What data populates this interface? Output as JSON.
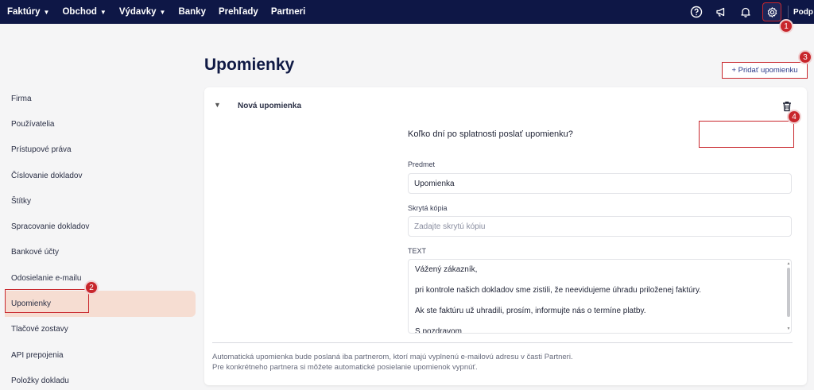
{
  "nav": {
    "items": [
      {
        "label": "Faktúry",
        "dropdown": true
      },
      {
        "label": "Obchod",
        "dropdown": true
      },
      {
        "label": "Výdavky",
        "dropdown": true
      },
      {
        "label": "Banky",
        "dropdown": false
      },
      {
        "label": "Prehľady",
        "dropdown": false
      },
      {
        "label": "Partneri",
        "dropdown": false
      }
    ],
    "icons": [
      "help-icon",
      "megaphone-icon",
      "bell-icon",
      "gear-icon"
    ],
    "user_label": "Podp"
  },
  "callouts": [
    "1",
    "2",
    "3",
    "4"
  ],
  "sidebar": {
    "items": [
      {
        "label": "Firma"
      },
      {
        "label": "Používatelia"
      },
      {
        "label": "Prístupové práva"
      },
      {
        "label": "Číslovanie dokladov"
      },
      {
        "label": "Štítky"
      },
      {
        "label": "Spracovanie dokladov"
      },
      {
        "label": "Bankové účty"
      },
      {
        "label": "Odosielanie e-mailu"
      },
      {
        "label": "Upomienky",
        "active": true
      },
      {
        "label": "Tlačové zostavy"
      },
      {
        "label": "API prepojenia"
      },
      {
        "label": "Položky dokladu"
      }
    ]
  },
  "main": {
    "title": "Upomienky",
    "add_button": "+ Pridať upomienku",
    "card": {
      "title": "Nová upomienka",
      "days_question": "Koľko dní po splatnosti poslať upomienku?",
      "days_value": "",
      "subject_label": "Predmet",
      "subject_value": "Upomienka",
      "bcc_label": "Skrytá kópia",
      "bcc_placeholder": "Zadajte skrytú kópiu",
      "text_label": "TEXT",
      "text_lines": [
        "Vážený zákazník,",
        "pri kontrole našich dokladov sme zistili, že neevidujeme úhradu priloženej faktúry.",
        "Ak ste faktúru už uhradili, prosím, informujte nás o termíne platby.",
        "S pozdravom"
      ],
      "note_lines": [
        "Automatická upomienka bude poslaná iba partnerom, ktorí majú vyplnenú e-mailovú adresu v časti Partneri.",
        "Pre konkrétneho partnera si môžete automatické posielanie upomienok vypnúť."
      ]
    }
  },
  "colors": {
    "nav_bg": "#0e1746",
    "highlight": "#c8262c",
    "active_bg": "#f6ddd2",
    "link": "#2b3a8a"
  }
}
